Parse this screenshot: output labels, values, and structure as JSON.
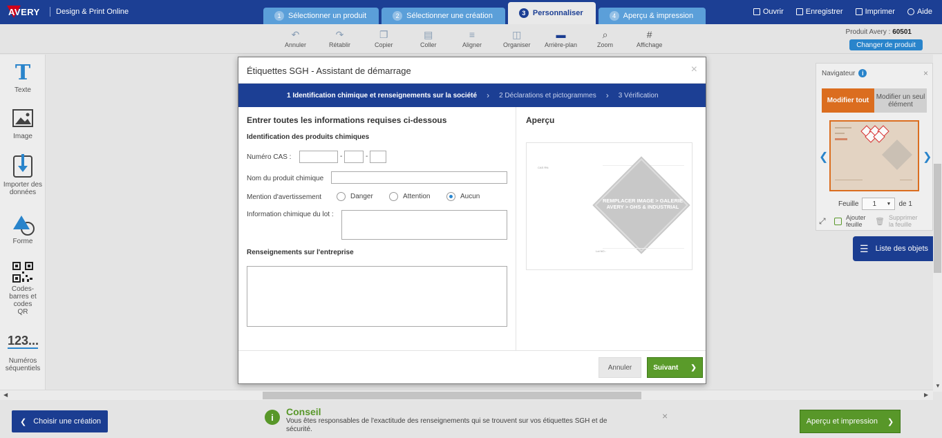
{
  "brand": {
    "logo": "AVERY",
    "subtitle": "Design & Print Online"
  },
  "steps": [
    {
      "num": "1",
      "label": "Sélectionner un produit"
    },
    {
      "num": "2",
      "label": "Sélectionner une création"
    },
    {
      "num": "3",
      "label": "Personnaliser"
    },
    {
      "num": "4",
      "label": "Aperçu & impression"
    }
  ],
  "top_actions": {
    "open": "Ouvrir",
    "save": "Enregistrer",
    "print": "Imprimer",
    "help": "Aide"
  },
  "toolbar": {
    "undo": "Annuler",
    "redo": "Rétablir",
    "copy": "Copier",
    "paste": "Coller",
    "align": "Aligner",
    "arrange": "Organiser",
    "background": "Arrière-plan",
    "zoom": "Zoom",
    "display": "Affichage",
    "product_label": "Produit Avery :",
    "product_code": "60501",
    "change_product": "Changer de produit"
  },
  "left_panel": {
    "text": "Texte",
    "image": "Image",
    "import": "Importer des données",
    "shape": "Forme",
    "barcodes": "Codes-barres et codes QR",
    "seq_icon": "123...",
    "seq": "Numéros séquentiels"
  },
  "navigator": {
    "title": "Navigateur",
    "info": "i",
    "close": "×",
    "edit_all": "Modifier tout",
    "edit_one": "Modifier un seul élément",
    "sheet_label": "Feuille",
    "sheet_value": "1",
    "sheet_of": "de 1",
    "add_sheet": "Ajouter feuille",
    "delete_sheet": "Supprimer la feuille"
  },
  "objects_list": "Liste des objets",
  "bottom": {
    "choose_design": "Choisir une création",
    "tip_icon": "i",
    "tip_title": "Conseil",
    "tip_text": "Vous êtes responsables de l'exactitude des renseignements qui se trouvent sur vos étiquettes SGH et de sécurité.",
    "tip_close": "×",
    "preview_print": "Aperçu et impression"
  },
  "modal": {
    "title": "Étiquettes SGH - Assistant de démarrage",
    "close": "×",
    "wizard": {
      "step1": "1 Identification chimique et renseignements sur la société",
      "step2": "2 Déclarations et pictogrammes",
      "step3": "3 Vérification"
    },
    "heading": "Entrer toutes les informations requises ci-dessous",
    "section_chem": "Identification des produits chimiques",
    "cas_label": "Numéro CAS :",
    "name_label": "Nom du produit chimique",
    "warning_label": "Mention d'avertissement",
    "radios": {
      "danger": "Danger",
      "attention": "Attention",
      "none": "Aucun",
      "selected": "Aucun"
    },
    "lot_label": "Information chimique du lot :",
    "section_company": "Renseignements sur l'entreprise",
    "preview_title": "Aperçu",
    "preview_cas": "CAS RN:",
    "preview_lot": "Lot NO.:",
    "preview_placeholder": "REMPLACER IMAGE > GALERIE AVERY > GHS & INDUSTRIAL",
    "cancel": "Annuler",
    "next": "Suivant"
  },
  "colors": {
    "brand_blue": "#1c3f94",
    "tab_blue": "#5b9fd9",
    "accent_orange": "#e07020",
    "action_green": "#5a9b2a",
    "link_blue": "#2a87d0"
  }
}
